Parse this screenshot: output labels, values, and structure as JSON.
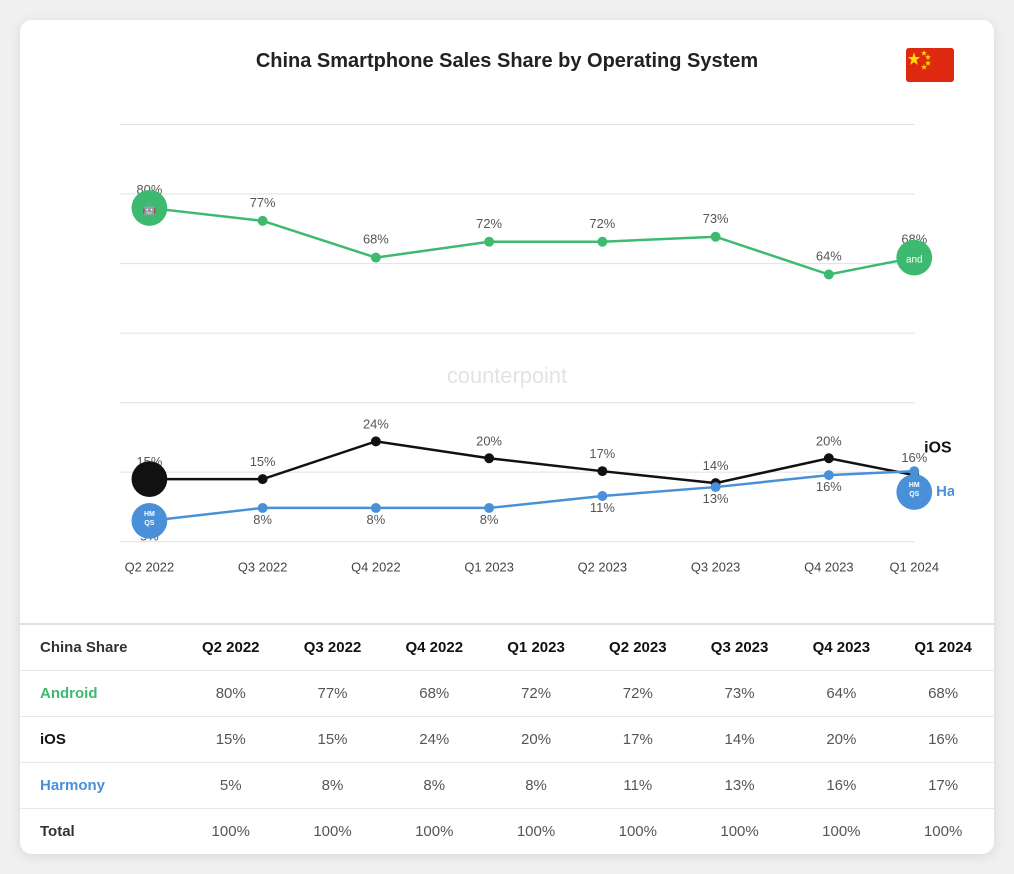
{
  "title": "China Smartphone Sales Share by Operating System",
  "quarters": [
    "Q2 2022",
    "Q3 2022",
    "Q4 2022",
    "Q1 2023",
    "Q2 2023",
    "Q3 2023",
    "Q4 2023",
    "Q1 2024"
  ],
  "android": {
    "label": "android",
    "values": [
      80,
      77,
      68,
      72,
      72,
      73,
      64,
      68
    ],
    "color": "#3dba6f"
  },
  "ios": {
    "label": "iOS",
    "values": [
      15,
      15,
      24,
      20,
      17,
      14,
      20,
      16
    ],
    "color": "#111111"
  },
  "harmony": {
    "label": "HarmonyOS",
    "values": [
      5,
      8,
      8,
      8,
      11,
      13,
      16,
      17
    ],
    "color": "#4a90d9"
  },
  "table": {
    "header": [
      "China Share",
      "Q2 2022",
      "Q3 2022",
      "Q4 2022",
      "Q1 2023",
      "Q2 2023",
      "Q3 2023",
      "Q4 2023",
      "Q1 2024"
    ],
    "rows": [
      {
        "name": "Android",
        "values": [
          "80%",
          "77%",
          "68%",
          "72%",
          "72%",
          "73%",
          "64%",
          "68%"
        ]
      },
      {
        "name": "iOS",
        "values": [
          "15%",
          "15%",
          "24%",
          "20%",
          "17%",
          "14%",
          "20%",
          "16%"
        ]
      },
      {
        "name": "Harmony",
        "values": [
          "5%",
          "8%",
          "8%",
          "8%",
          "11%",
          "13%",
          "16%",
          "17%"
        ]
      },
      {
        "name": "Total",
        "values": [
          "100%",
          "100%",
          "100%",
          "100%",
          "100%",
          "100%",
          "100%",
          "100%"
        ]
      }
    ]
  },
  "flag": {
    "bg": "#DE2910",
    "star_color": "#FFDE00"
  }
}
